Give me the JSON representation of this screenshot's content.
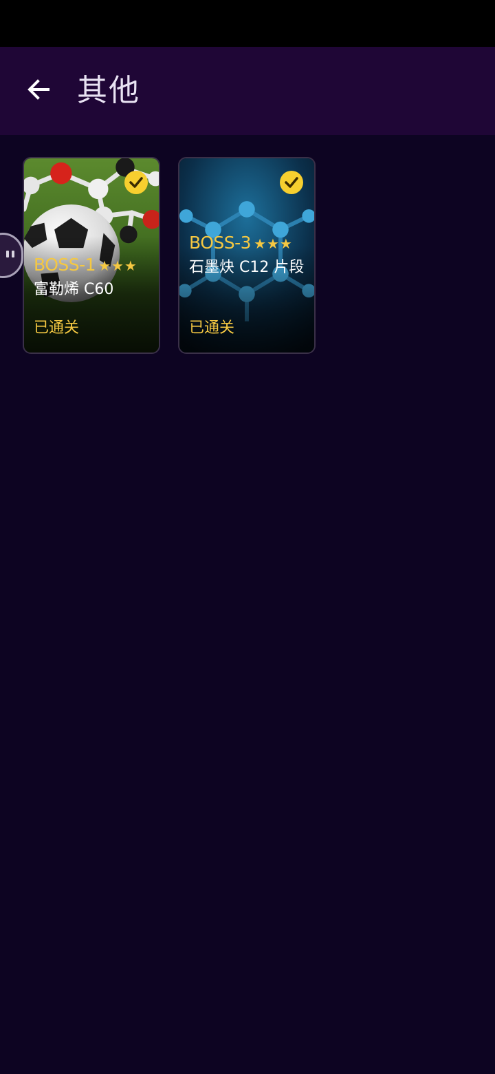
{
  "header": {
    "back_icon": "arrow-left-icon",
    "title": "其他"
  },
  "levels": [
    {
      "boss": "BOSS-1",
      "stars": "★★★",
      "name": "富勒烯 C60",
      "status": "已通关",
      "completed_icon": "check-circle-icon"
    },
    {
      "boss": "BOSS-3",
      "stars": "★★★",
      "name": "石墨炔 C12 片段",
      "status": "已通关",
      "completed_icon": "check-circle-icon"
    }
  ],
  "colors": {
    "accent": "#f5c842",
    "background": "#0d0422",
    "app_bar": "#1f0636"
  }
}
